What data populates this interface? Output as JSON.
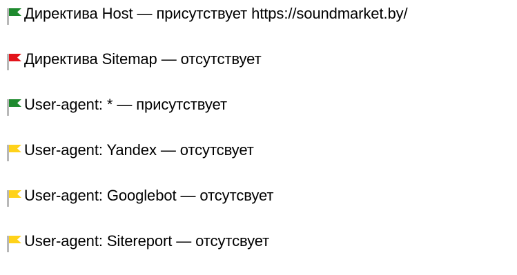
{
  "checks": [
    {
      "text": "Директива Host — присутствует https://soundmarket.by/",
      "status": "ok",
      "flag_icon": "flag-green-icon",
      "flag_color": "#1e8a2e"
    },
    {
      "text": "Директива Sitemap — отсутствует",
      "status": "error",
      "flag_icon": "flag-red-icon",
      "flag_color": "#e3141b"
    },
    {
      "text": "User-agent: * — присутствует",
      "status": "ok",
      "flag_icon": "flag-green-icon",
      "flag_color": "#1e8a2e"
    },
    {
      "text": "User-agent: Yandex — отсутсвует",
      "status": "warning",
      "flag_icon": "flag-yellow-icon",
      "flag_color": "#ffd21a"
    },
    {
      "text": "User-agent: Googlebot — отсутсвует",
      "status": "warning",
      "flag_icon": "flag-yellow-icon",
      "flag_color": "#ffd21a"
    },
    {
      "text": "User-agent: Sitereport — отсутсвует",
      "status": "warning",
      "flag_icon": "flag-yellow-icon",
      "flag_color": "#ffd21a"
    }
  ],
  "colors": {
    "pole": "#b8b8b8",
    "text": "#000000"
  }
}
